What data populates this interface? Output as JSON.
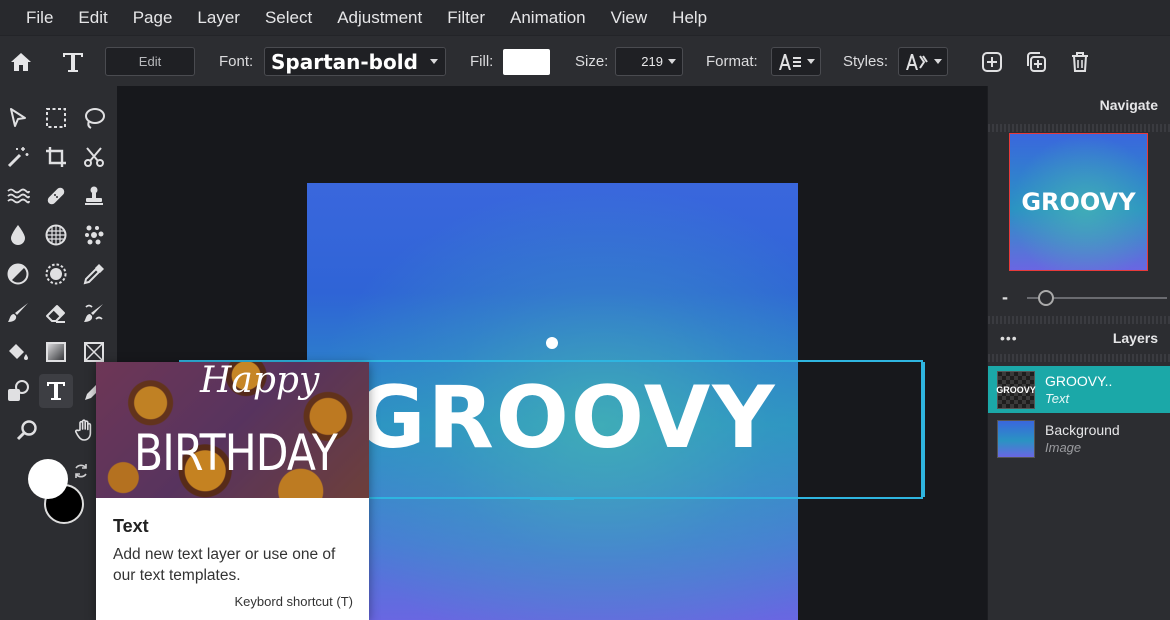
{
  "menu": [
    "File",
    "Edit",
    "Page",
    "Layer",
    "Select",
    "Adjustment",
    "Filter",
    "Animation",
    "View",
    "Help"
  ],
  "toolbar": {
    "edit_label": "Edit",
    "font_label": "Font:",
    "font_value": "Spartan-bold",
    "fill_label": "Fill:",
    "fill_color": "#ffffff",
    "size_label": "Size:",
    "size_value": "219",
    "format_label": "Format:",
    "styles_label": "Styles:"
  },
  "canvas": {
    "text": "GROOVY"
  },
  "tooltip": {
    "image_line1": "Happy",
    "image_line2": "BIRTHDAY",
    "title": "Text",
    "description": "Add new text layer or use one of our text templates.",
    "shortcut": "Keybord shortcut (T)"
  },
  "navigate": {
    "title": "Navigate",
    "thumb_text": "GROOVY",
    "zoom_minus": "-"
  },
  "layers": {
    "title": "Layers",
    "dots": "•••",
    "items": [
      {
        "name": "GROOVY..",
        "kind": "Text",
        "thumb": "GROOVY"
      },
      {
        "name": "Background",
        "kind": "Image"
      }
    ]
  },
  "colors": {
    "accent": "#2fb5e0",
    "selected_layer": "#1ba8a8",
    "foreground": "#ffffff",
    "background": "#000000"
  }
}
